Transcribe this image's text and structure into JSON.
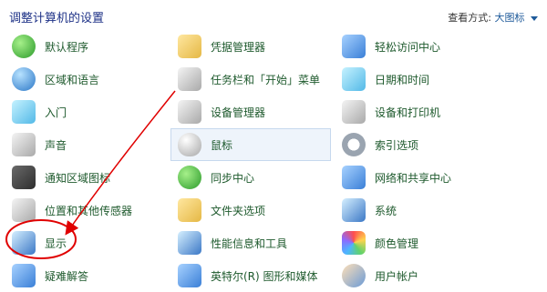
{
  "header": {
    "title": "调整计算机的设置",
    "view_by_label": "查看方式:",
    "view_by_value": "大图标"
  },
  "items": {
    "col1": [
      {
        "label": "默认程序",
        "icon": "default-programs-icon"
      },
      {
        "label": "区域和语言",
        "icon": "region-language-icon"
      },
      {
        "label": "入门",
        "icon": "getting-started-icon"
      },
      {
        "label": "声音",
        "icon": "sound-icon"
      },
      {
        "label": "通知区域图标",
        "icon": "notification-area-icon"
      },
      {
        "label": "位置和其他传感器",
        "icon": "location-sensors-icon"
      },
      {
        "label": "显示",
        "icon": "display-icon"
      },
      {
        "label": "疑难解答",
        "icon": "troubleshooting-icon"
      }
    ],
    "col2": [
      {
        "label": "凭据管理器",
        "icon": "credential-manager-icon"
      },
      {
        "label": "任务栏和「开始」菜单",
        "icon": "taskbar-start-menu-icon"
      },
      {
        "label": "设备管理器",
        "icon": "device-manager-icon"
      },
      {
        "label": "鼠标",
        "icon": "mouse-icon"
      },
      {
        "label": "同步中心",
        "icon": "sync-center-icon"
      },
      {
        "label": "文件夹选项",
        "icon": "folder-options-icon"
      },
      {
        "label": "性能信息和工具",
        "icon": "performance-tools-icon"
      },
      {
        "label": "英特尔(R) 图形和媒体",
        "icon": "intel-graphics-icon"
      }
    ],
    "col3": [
      {
        "label": "轻松访问中心",
        "icon": "ease-of-access-icon"
      },
      {
        "label": "日期和时间",
        "icon": "date-time-icon"
      },
      {
        "label": "设备和打印机",
        "icon": "devices-printers-icon"
      },
      {
        "label": "索引选项",
        "icon": "indexing-options-icon"
      },
      {
        "label": "网络和共享中心",
        "icon": "network-sharing-icon"
      },
      {
        "label": "系统",
        "icon": "system-icon"
      },
      {
        "label": "颜色管理",
        "icon": "color-management-icon"
      },
      {
        "label": "用户帐户",
        "icon": "user-accounts-icon"
      }
    ]
  },
  "annotation": {
    "ellipse_color": "#e00000",
    "arrow_color": "#e00000"
  }
}
